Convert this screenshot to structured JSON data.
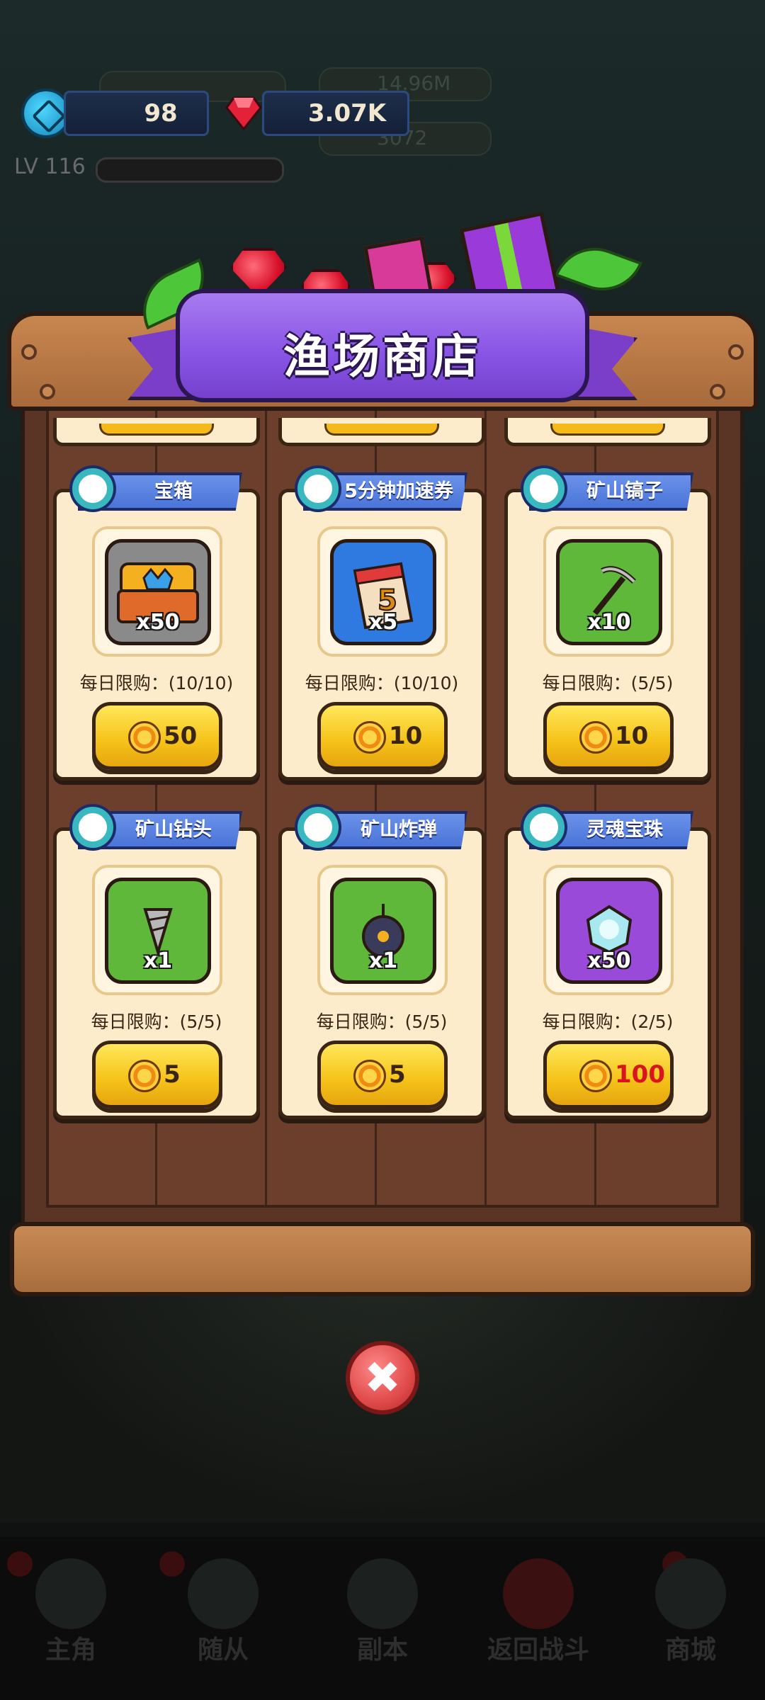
{
  "header": {
    "fish_currency": "98",
    "gems": "3.07K",
    "level": "LV 116",
    "dim_gold": "14.96M",
    "dim_second": "3072"
  },
  "shop": {
    "title": "渔场商店",
    "items": [
      {
        "name": "宝箱",
        "icon": "treasure-chest-icon",
        "qty": "x50",
        "limit": "每日限购：(10/10)",
        "price": "50",
        "price_red": false
      },
      {
        "name": "5分钟加速券",
        "icon": "calendar-speedup-icon",
        "qty": "x5",
        "limit": "每日限购：(10/10)",
        "price": "10",
        "price_red": false
      },
      {
        "name": "矿山镐子",
        "icon": "pickaxe-icon",
        "qty": "x10",
        "limit": "每日限购：(5/5)",
        "price": "10",
        "price_red": false
      },
      {
        "name": "矿山钻头",
        "icon": "drill-bit-icon",
        "qty": "x1",
        "limit": "每日限购：(5/5)",
        "price": "5",
        "price_red": false
      },
      {
        "name": "矿山炸弹",
        "icon": "bomb-icon",
        "qty": "x1",
        "limit": "每日限购：(5/5)",
        "price": "5",
        "price_red": false
      },
      {
        "name": "灵魂宝珠",
        "icon": "soul-orb-icon",
        "qty": "x50",
        "limit": "每日限购：(2/5)",
        "price": "100",
        "price_red": true
      }
    ]
  },
  "nav": {
    "items": [
      "主角",
      "随从",
      "副本",
      "返回战斗",
      "商城"
    ]
  },
  "colors": {
    "banner": "#8a56e6",
    "card": "#fdeccc",
    "buy_button": "#f5c218",
    "tag": "#4a74d8",
    "price_red": "#d8141e"
  }
}
